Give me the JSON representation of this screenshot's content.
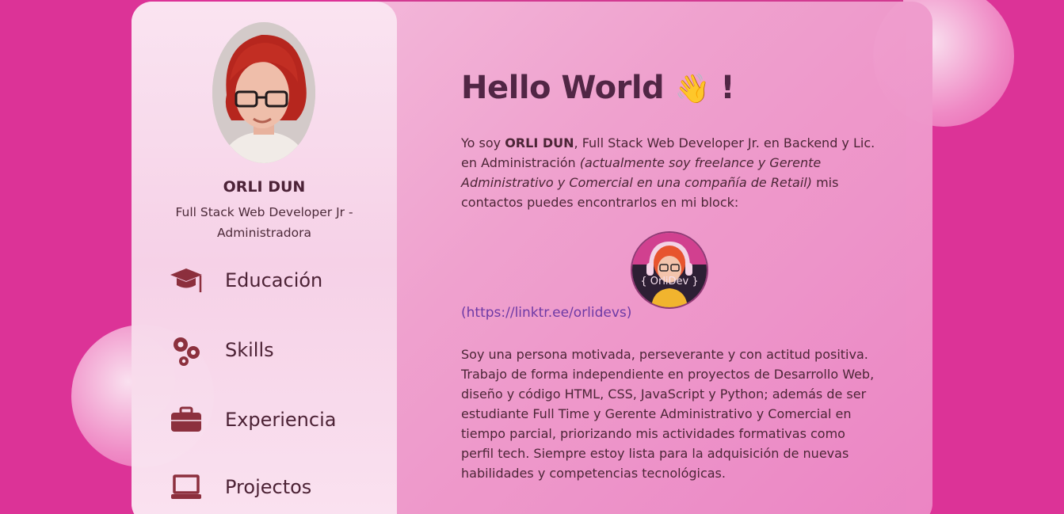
{
  "profile": {
    "name": "ORLI DUN",
    "role": "Full Stack Web Developer Jr - Administradora"
  },
  "nav": [
    {
      "label": "Educación",
      "icon": "graduation-cap-icon"
    },
    {
      "label": "Skills",
      "icon": "gears-icon"
    },
    {
      "label": "Experiencia",
      "icon": "briefcase-icon"
    },
    {
      "label": "Projectos",
      "icon": "laptop-icon"
    }
  ],
  "main": {
    "greeting": "Hello World",
    "greeting_emoji": "👋",
    "greeting_suffix": "!",
    "intro_a": "Yo soy ",
    "intro_name": "ORLI DUN",
    "intro_b": ", Full Stack Web Developer Jr. en Backend y Lic. en Administración ",
    "intro_italic": "(actualmente soy freelance y Gerente Administrativo y Comercial en una compañía de Retail)",
    "intro_c": " mis contactos puedes encontrarlos en mi block:",
    "logo_text": "{ OrliDev }",
    "link": "(https://linktr.ee/orlidevs)",
    "about": "Soy una persona motivada, perseverante y con actitud positiva. Trabajo de forma independiente en proyectos de Desarrollo Web, diseño y código HTML, CSS, JavaScript y Python; además de ser estudiante Full Time y Gerente Administrativo y Comercial en tiempo parcial, priorizando mis actividades formativas como perfil tech. Siempre estoy lista para la adquisición de nuevas habilidades y competencias tecnológicas."
  },
  "colors": {
    "background": "#dc3397",
    "icon": "#8b2f3c",
    "heading": "#4f2644",
    "link": "#6b3aa6"
  }
}
